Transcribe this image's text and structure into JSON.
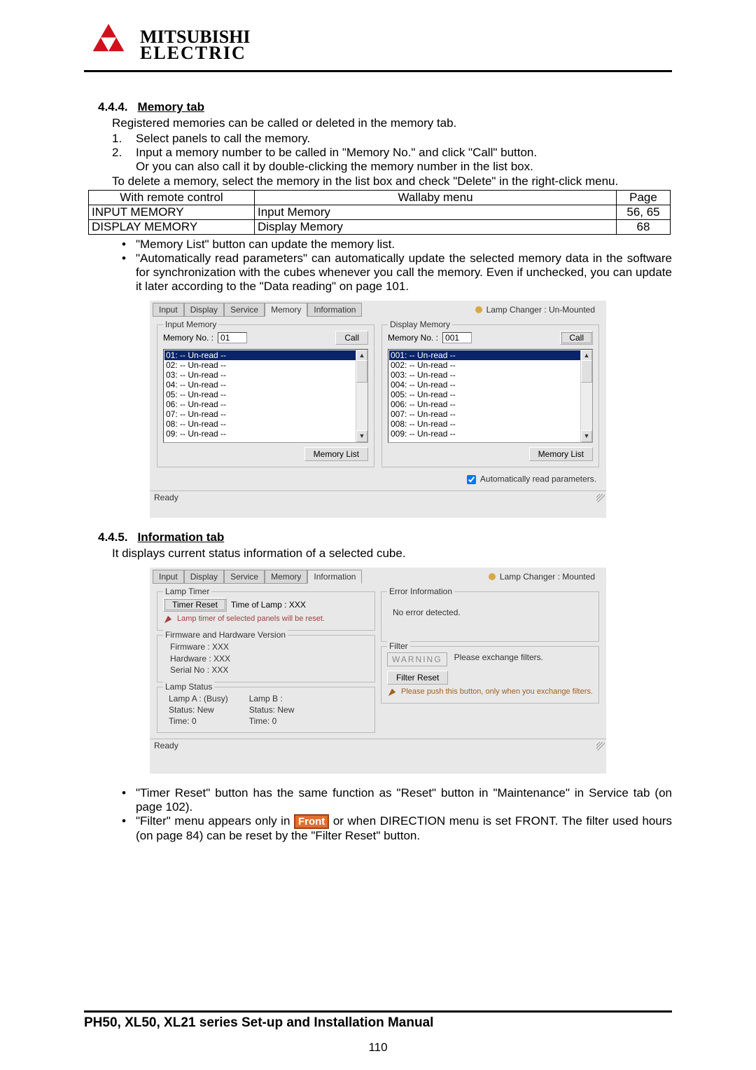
{
  "logo": {
    "brand1": "MITSUBISHI",
    "brand2": "ELECTRIC"
  },
  "sec444": {
    "num": "4.4.4.",
    "title": "Memory tab",
    "intro": "Registered memories can be called or deleted in the memory tab.",
    "s1n": "1.",
    "s1": "Select panels to call the memory.",
    "s2n": "2.",
    "s2": "Input a memory number to be called in \"Memory No.\" and click \"Call\" button.",
    "s2b": "Or you can also call it by double-clicking the memory number in the list box.",
    "del": "To delete a memory, select the memory in the list box and check \"Delete\" in the right-click menu.",
    "tbl": {
      "h1": "With remote control",
      "h2": "Wallaby menu",
      "h3": "Page",
      "r1c1": "INPUT MEMORY",
      "r1c2": "Input Memory",
      "r1c3": "56, 65",
      "r2c1": "DISPLAY MEMORY",
      "r2c2": "Display Memory",
      "r2c3": "68"
    },
    "b1": "\"Memory List\" button can update the memory list.",
    "b2": "\"Automatically read parameters\" can automatically update the selected memory data in the software for synchronization with the cubes whenever you call the memory. Even if unchecked, you can update it later according to the \"Data reading\" on page 101."
  },
  "fig1": {
    "tabs": [
      "Input",
      "Display",
      "Service",
      "Memory",
      "Information"
    ],
    "active_tab": 3,
    "lamp": "Lamp Changer :   Un-Mounted",
    "inputmem": {
      "legend": "Input Memory",
      "memno_lbl": "Memory No. :",
      "memno_val": "01",
      "call": "Call",
      "items": [
        "01: -- Un-read --",
        "02: -- Un-read --",
        "03: -- Un-read --",
        "04: -- Un-read --",
        "05: -- Un-read --",
        "06: -- Un-read --",
        "07: -- Un-read --",
        "08: -- Un-read --",
        "09: -- Un-read --"
      ],
      "btn_list": "Memory List"
    },
    "dispmem": {
      "legend": "Display Memory",
      "memno_lbl": "Memory No. :",
      "memno_val": "001",
      "call": "Call",
      "items": [
        "001: -- Un-read --",
        "002: -- Un-read --",
        "003: -- Un-read --",
        "004: -- Un-read --",
        "005: -- Un-read --",
        "006: -- Un-read --",
        "007: -- Un-read --",
        "008: -- Un-read --",
        "009: -- Un-read --"
      ],
      "btn_list": "Memory List"
    },
    "autochk": "Automatically read parameters.",
    "status": "Ready"
  },
  "sec445": {
    "num": "4.4.5.",
    "title": "Information tab",
    "intro": "It displays current status information of a selected cube."
  },
  "fig2": {
    "tabs": [
      "Input",
      "Display",
      "Service",
      "Memory",
      "Information"
    ],
    "active_tab": 4,
    "lamp": "Lamp Changer :   Mounted",
    "lamptimer": {
      "legend": "Lamp Timer",
      "btn": "Timer Reset",
      "tol": "Time of Lamp : XXX",
      "hint": "Lamp timer of selected panels will be reset."
    },
    "fw": {
      "legend": "Firmware and Hardware Version",
      "l1": "Firmware :  XXX",
      "l2": "Hardware :  XXX",
      "l3": "Serial No :  XXX"
    },
    "lampstatus": {
      "legend": "Lamp Status",
      "a1": "Lamp A : (Busy)",
      "a2": "Status: New",
      "a3": "Time:  0",
      "b1": "Lamp B :",
      "b2": "Status:  New",
      "b3": "Time:   0"
    },
    "errinfo": {
      "legend": "Error Information",
      "txt": "No error detected."
    },
    "filter": {
      "legend": "Filter",
      "warn": "WARNING",
      "msg": "Please exchange filters.",
      "btn": "Filter Reset",
      "hint": "Please push this button, only when you exchange filters."
    },
    "status": "Ready"
  },
  "endbullets": {
    "b1": "\"Timer Reset\" button has the same function as \"Reset\" button in \"Maintenance\" in Service tab (on page 102).",
    "b2a": "\"Filter\" menu appears only in ",
    "front": "Front",
    "b2b": " or when DIRECTION menu is set FRONT. The filter used hours (on page 84) can be reset by the \"Filter Reset\" button."
  },
  "footer": "PH50, XL50, XL21 series Set-up and Installation Manual",
  "pagenum": "110"
}
